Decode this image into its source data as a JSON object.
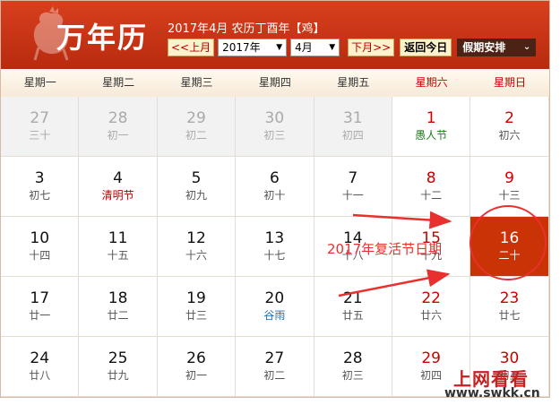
{
  "header": {
    "logo": "万年历",
    "date_info": "2017年4月 农历丁酉年【鸡】",
    "prev_month_label": "<<上月",
    "year_value": "2017年",
    "month_value": "4月",
    "next_month_label": "下月>>",
    "today_label": "返回今日",
    "holiday_label": "假期安排"
  },
  "weekdays": [
    "星期一",
    "星期二",
    "星期三",
    "星期四",
    "星期五",
    "星期六",
    "星期日"
  ],
  "weeks": [
    [
      {
        "num": "27",
        "sub": "三十"
      },
      {
        "num": "28",
        "sub": "初一"
      },
      {
        "num": "29",
        "sub": "初二"
      },
      {
        "num": "30",
        "sub": "初三"
      },
      {
        "num": "31",
        "sub": "初四"
      },
      {
        "num": "1",
        "sub": "愚人节"
      },
      {
        "num": "2",
        "sub": "初六"
      }
    ],
    [
      {
        "num": "3",
        "sub": "初七"
      },
      {
        "num": "4",
        "sub": "清明节"
      },
      {
        "num": "5",
        "sub": "初九"
      },
      {
        "num": "6",
        "sub": "初十"
      },
      {
        "num": "7",
        "sub": "十一"
      },
      {
        "num": "8",
        "sub": "十二"
      },
      {
        "num": "9",
        "sub": "十三"
      }
    ],
    [
      {
        "num": "10",
        "sub": "十四"
      },
      {
        "num": "11",
        "sub": "十五"
      },
      {
        "num": "12",
        "sub": "十六"
      },
      {
        "num": "13",
        "sub": "十七"
      },
      {
        "num": "14",
        "sub": "十八"
      },
      {
        "num": "15",
        "sub": "十九"
      },
      {
        "num": "16",
        "sub": "二十"
      }
    ],
    [
      {
        "num": "17",
        "sub": "廿一"
      },
      {
        "num": "18",
        "sub": "廿二"
      },
      {
        "num": "19",
        "sub": "廿三"
      },
      {
        "num": "20",
        "sub": "谷雨"
      },
      {
        "num": "21",
        "sub": "廿五"
      },
      {
        "num": "22",
        "sub": "廿六"
      },
      {
        "num": "23",
        "sub": "廿七"
      }
    ],
    [
      {
        "num": "24",
        "sub": "廿八"
      },
      {
        "num": "25",
        "sub": "廿九"
      },
      {
        "num": "26",
        "sub": "初一"
      },
      {
        "num": "27",
        "sub": "初二"
      },
      {
        "num": "28",
        "sub": "初三"
      },
      {
        "num": "29",
        "sub": "初四"
      },
      {
        "num": "30",
        "sub": "初五"
      }
    ]
  ],
  "annotation": "2017年复活节日期",
  "watermark": {
    "title": "上网看看",
    "url": "www.swkk.cn"
  },
  "colors": {
    "header": "#c8350f",
    "today": "#c93306",
    "annotation": "#e8312e",
    "weekend": "#cc0000"
  }
}
